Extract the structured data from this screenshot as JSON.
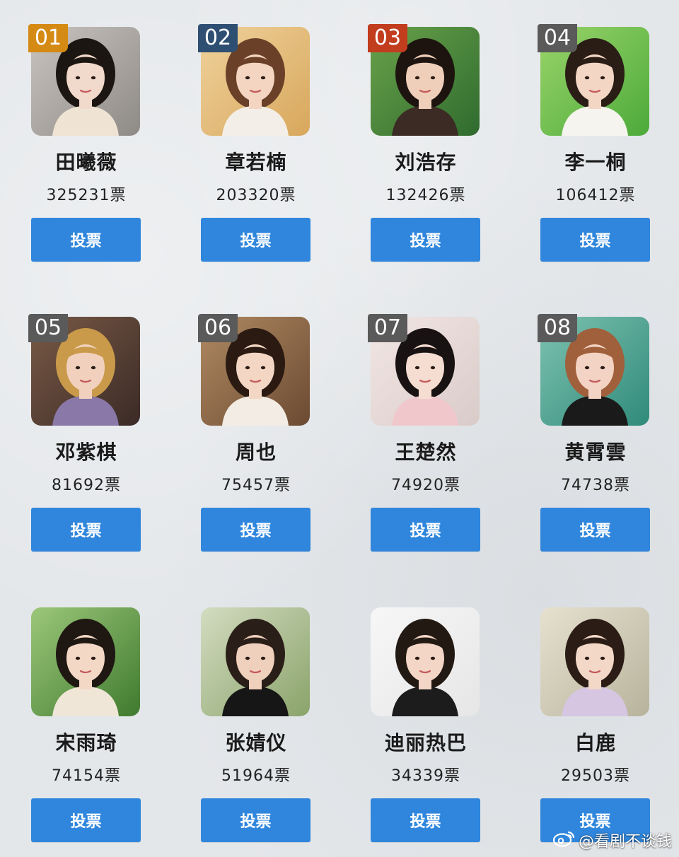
{
  "button_label": "投票",
  "watermark": {
    "text": "@看剧不谈钱",
    "icon": "weibo-icon"
  },
  "candidates": [
    {
      "rank": "01",
      "name": "田曦薇",
      "votes": "325231票",
      "rank_color": "#d58a14",
      "photo": {
        "bg": "#8e8a86",
        "bg2": "#c9c4bf",
        "hair": "#1c1612",
        "skin": "#f1d9cb",
        "top": "#efe3d4"
      }
    },
    {
      "rank": "02",
      "name": "章若楠",
      "votes": "203320票",
      "rank_color": "#2e4f72",
      "photo": {
        "bg": "#d8a75c",
        "bg2": "#efd29c",
        "hair": "#6a4128",
        "skin": "#f4d5c2",
        "top": "#f3efe8"
      }
    },
    {
      "rank": "03",
      "name": "刘浩存",
      "votes": "132426票",
      "rank_color": "#c23c1e",
      "photo": {
        "bg": "#2f6b2f",
        "bg2": "#6aa24a",
        "hair": "#1d1410",
        "skin": "#f0cfba",
        "top": "#3b2b24"
      }
    },
    {
      "rank": "04",
      "name": "李一桐",
      "votes": "106412票",
      "rank_color": "#5a5a5a",
      "photo": {
        "bg": "#4caa3a",
        "bg2": "#9ad46a",
        "hair": "#2a1d16",
        "skin": "#f3d6c4",
        "top": "#f6f4ef"
      }
    },
    {
      "rank": "05",
      "name": "邓紫棋",
      "votes": "81692票",
      "rank_color": "#5a5a5a",
      "photo": {
        "bg": "#3a2a26",
        "bg2": "#7a5a46",
        "hair": "#c99a4a",
        "skin": "#f1d1bd",
        "top": "#8a78a8"
      }
    },
    {
      "rank": "06",
      "name": "周也",
      "votes": "75457票",
      "rank_color": "#5a5a5a",
      "photo": {
        "bg": "#6b4a32",
        "bg2": "#b08a62",
        "hair": "#2a1a12",
        "skin": "#f3d6c3",
        "top": "#f3ece4"
      }
    },
    {
      "rank": "07",
      "name": "王楚然",
      "votes": "74920票",
      "rank_color": "#5a5a5a",
      "photo": {
        "bg": "#d9cbc8",
        "bg2": "#f2e6e4",
        "hair": "#181212",
        "skin": "#f6ddd2",
        "top": "#f0c8cc"
      }
    },
    {
      "rank": "08",
      "name": "黄霄雲",
      "votes": "74738票",
      "rank_color": "#5a5a5a",
      "photo": {
        "bg": "#2f8a7a",
        "bg2": "#7ec2b0",
        "hair": "#a0603c",
        "skin": "#f3d3c3",
        "top": "#1a1a1a"
      }
    },
    {
      "rank": "",
      "name": "宋雨琦",
      "votes": "74154票",
      "rank_color": "#5a5a5a",
      "photo": {
        "bg": "#3f7a2e",
        "bg2": "#9cc77a",
        "hair": "#1f1712",
        "skin": "#f4d8c6",
        "top": "#efe6d8"
      }
    },
    {
      "rank": "",
      "name": "张婧仪",
      "votes": "51964票",
      "rank_color": "#5a5a5a",
      "photo": {
        "bg": "#8aa36a",
        "bg2": "#d3dcc1",
        "hair": "#2a1e18",
        "skin": "#efd0bc",
        "top": "#161616"
      }
    },
    {
      "rank": "",
      "name": "迪丽热巴",
      "votes": "34339票",
      "rank_color": "#5a5a5a",
      "photo": {
        "bg": "#e6e6e6",
        "bg2": "#f7f7f7",
        "hair": "#231913",
        "skin": "#f3d6c6",
        "top": "#1c1c1c"
      }
    },
    {
      "rank": "",
      "name": "白鹿",
      "votes": "29503票",
      "rank_color": "#5a5a5a",
      "photo": {
        "bg": "#b8b39c",
        "bg2": "#e6e1cf",
        "hair": "#2b1d15",
        "skin": "#f3d8c8",
        "top": "#d6c6e2"
      }
    }
  ]
}
